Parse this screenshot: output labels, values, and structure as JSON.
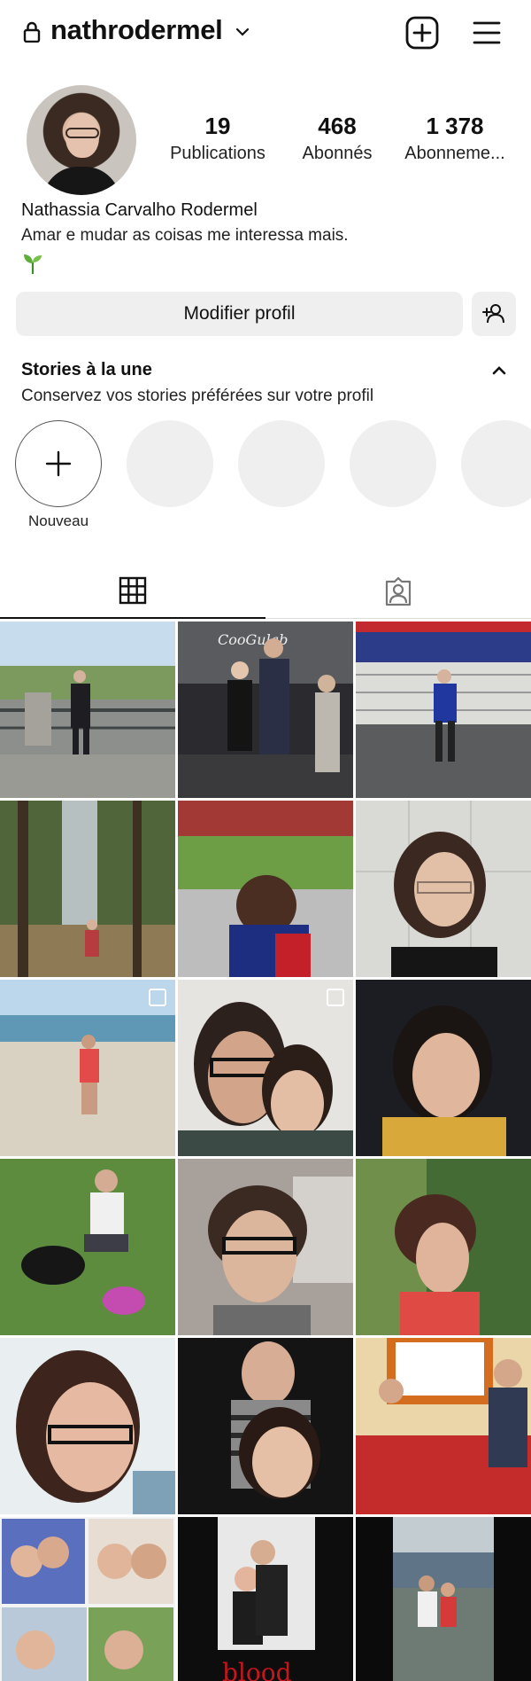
{
  "header": {
    "username": "nathrodermel"
  },
  "stats": [
    {
      "value": "19",
      "label": "Publications"
    },
    {
      "value": "468",
      "label": "Abonnés"
    },
    {
      "value": "1 378",
      "label": "Abonneme..."
    }
  ],
  "profile": {
    "full_name": "Nathassia Carvalho Rodermel",
    "bio": "Amar e mudar as coisas me interessa mais."
  },
  "buttons": {
    "edit_profile": "Modifier profil"
  },
  "highlights": {
    "title": "Stories à la une",
    "subtitle": "Conservez vos stories préférées sur votre profil",
    "new_label": "Nouveau"
  },
  "tabs": [
    "grid",
    "tagged"
  ],
  "posts": [
    {
      "scene": "lookout-railing",
      "multi": false
    },
    {
      "scene": "concert-couple",
      "multi": false
    },
    {
      "scene": "stadium-fence",
      "multi": false
    },
    {
      "scene": "waterfall",
      "multi": false
    },
    {
      "scene": "stadium-crowd",
      "multi": false
    },
    {
      "scene": "selfie-wall",
      "multi": false
    },
    {
      "scene": "beach",
      "multi": true
    },
    {
      "scene": "couple-selfie",
      "multi": true
    },
    {
      "scene": "selfie-yellow",
      "multi": false
    },
    {
      "scene": "dog-grass",
      "multi": false
    },
    {
      "scene": "selfie-room",
      "multi": false
    },
    {
      "scene": "short-hair-garden",
      "multi": false
    },
    {
      "scene": "selfie-bright",
      "multi": false
    },
    {
      "scene": "couple-dark",
      "multi": false
    },
    {
      "scene": "dinner-table",
      "multi": false
    },
    {
      "scene": "collage",
      "multi": false
    },
    {
      "scene": "movie-poster",
      "multi": false
    },
    {
      "scene": "rocky-coast",
      "multi": false
    }
  ]
}
